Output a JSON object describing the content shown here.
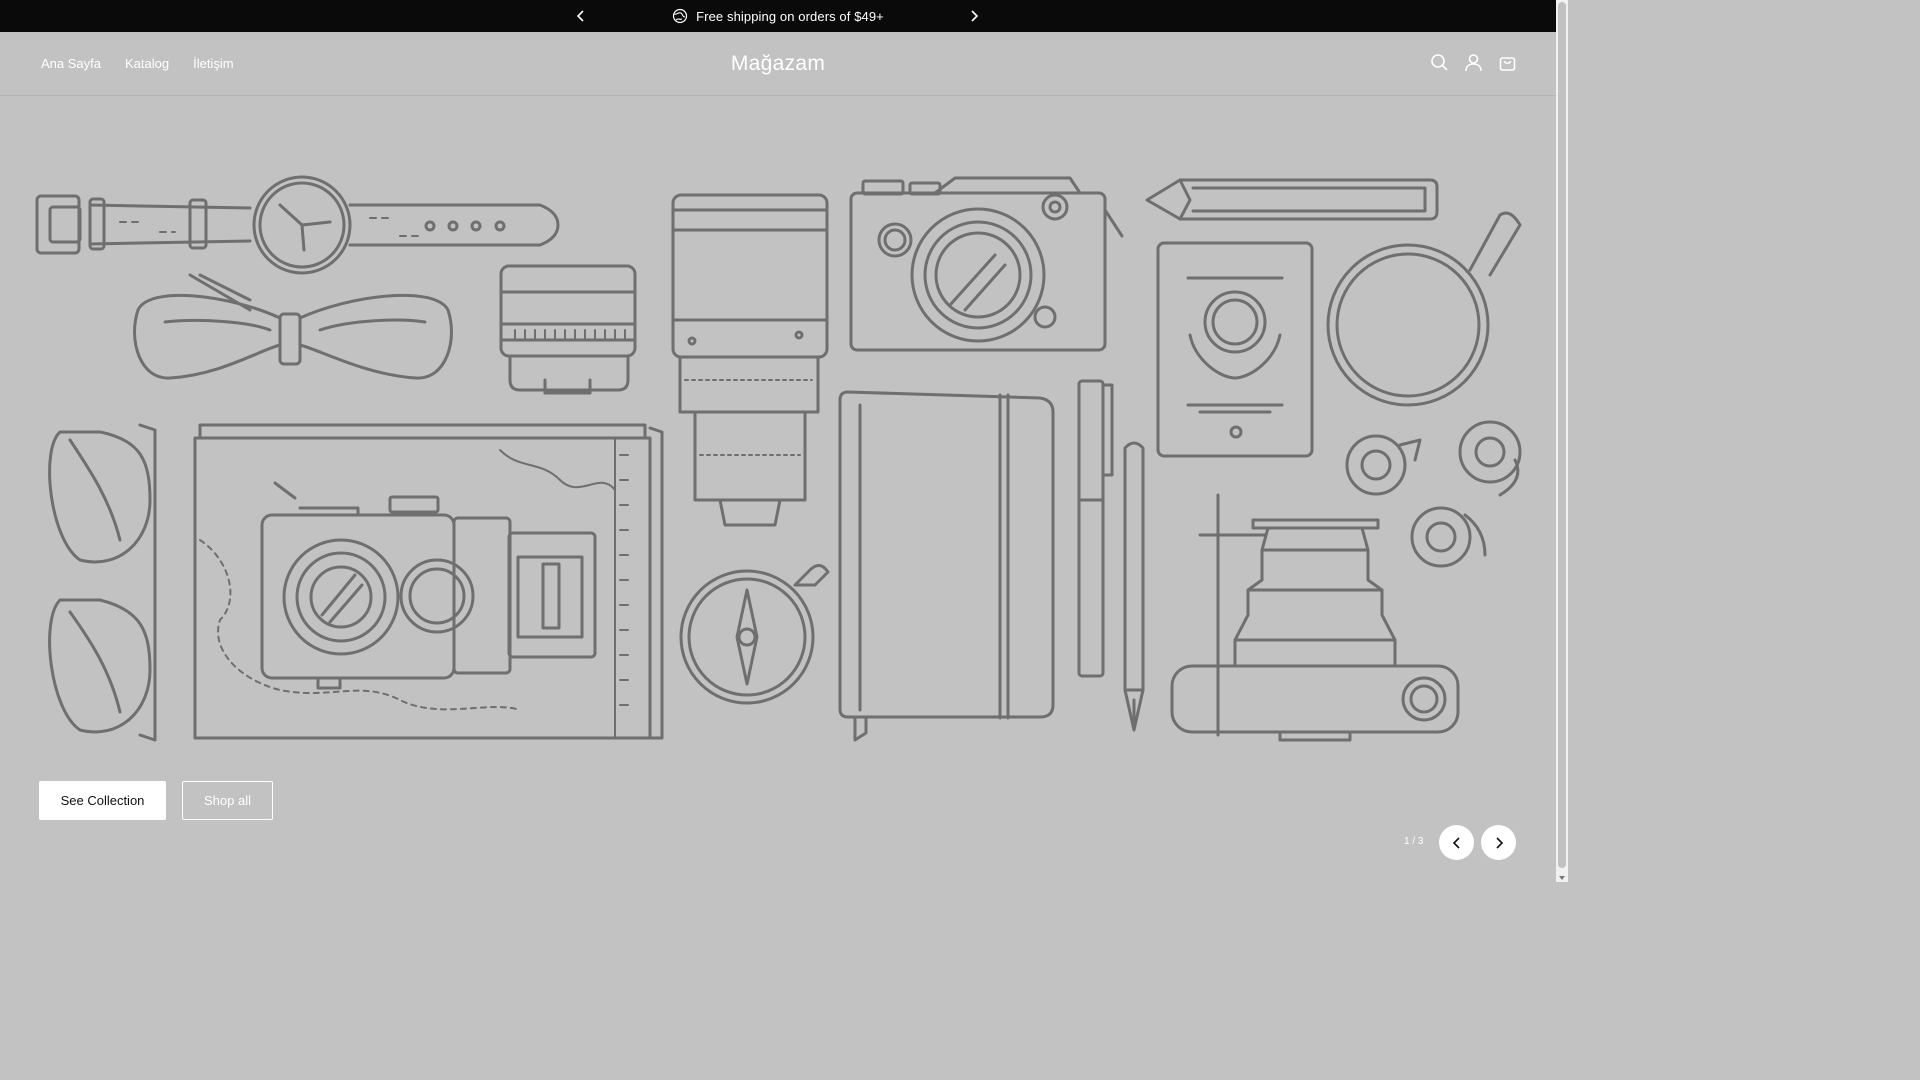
{
  "announcement": {
    "text": "Free shipping on orders of $49+",
    "icons": {
      "prev": "chevron-left-icon",
      "next": "chevron-right-icon",
      "badge": "globe-icon"
    }
  },
  "header": {
    "logo": "Mağazam",
    "nav": [
      {
        "label": "Ana Sayfa"
      },
      {
        "label": "Katalog"
      },
      {
        "label": "İletişim"
      }
    ],
    "icons": [
      "search-icon",
      "account-icon",
      "cart-icon"
    ]
  },
  "hero": {
    "primary_button": "See Collection",
    "secondary_button": "Shop all",
    "slide_counter": "1 / 3",
    "illustration": "travel-gear-line-illustration"
  },
  "colors": {
    "announcement_bg": "#0a0a0a",
    "hero_bg": "#c2c2c2",
    "illustration_stroke": "#6f6f6f",
    "text_light": "#ffffff"
  }
}
